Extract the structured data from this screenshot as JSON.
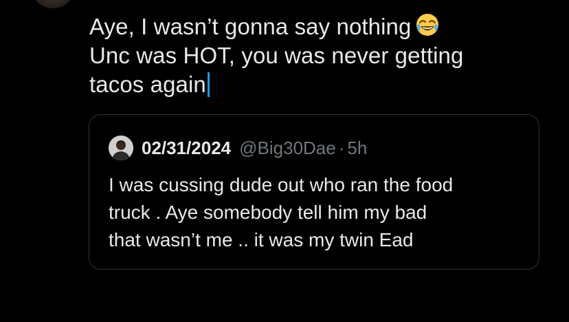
{
  "compose": {
    "lines": [
      "Aye, I wasn’t gonna say nothing",
      "Unc was HOT, you was never getting",
      "tacos again"
    ],
    "emoji": "face-with-tears-of-joy"
  },
  "quoted_post": {
    "display_name": "02/31/2024",
    "handle": "@Big30Dae",
    "separator": "·",
    "time": "5h",
    "lines": [
      "I was cussing dude out who ran the food",
      "truck . Aye somebody tell him my bad",
      "that wasn’t me .. it was my twin Ead"
    ]
  },
  "colors": {
    "background": "#000000",
    "text": "#e7e9ea",
    "muted": "#71767b",
    "border": "#2f3336",
    "caret": "#1d9bf0"
  }
}
